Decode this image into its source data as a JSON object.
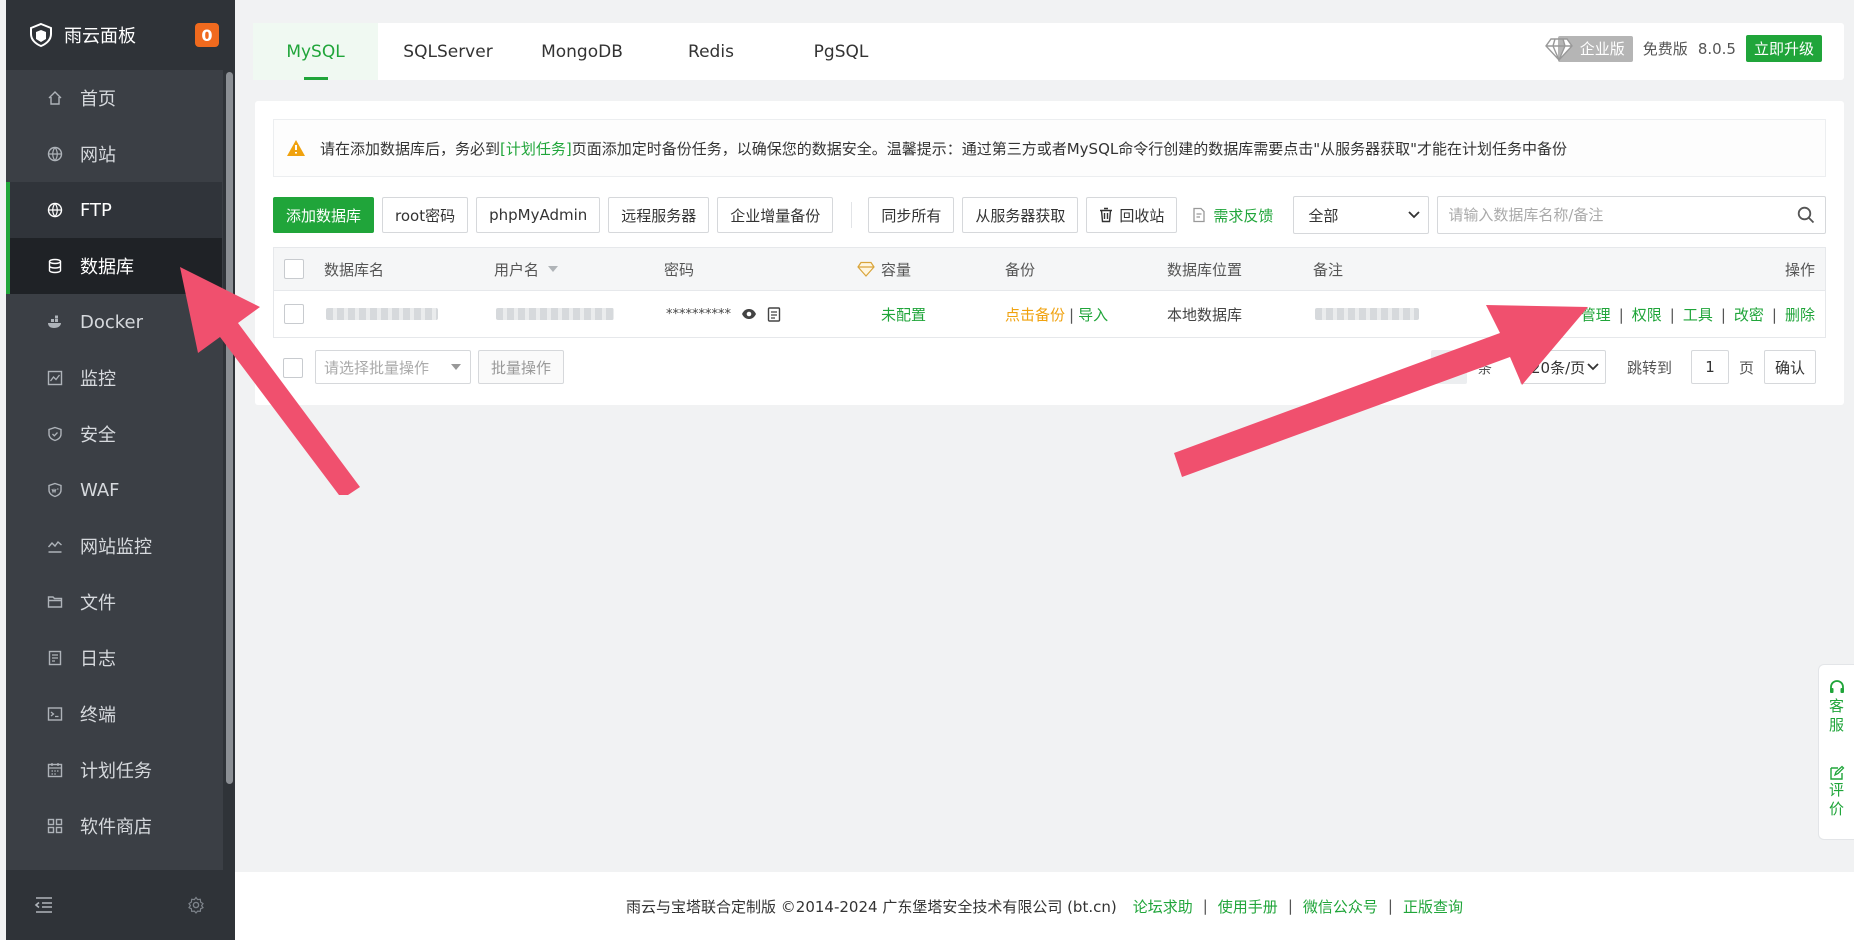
{
  "sidebar": {
    "brand": "雨云面板",
    "badge": "0",
    "items": [
      {
        "label": "首页",
        "icon": "home-icon"
      },
      {
        "label": "网站",
        "icon": "globe-icon"
      },
      {
        "label": "FTP",
        "icon": "ftp-globe-icon"
      },
      {
        "label": "数据库",
        "icon": "database-icon"
      },
      {
        "label": "Docker",
        "icon": "docker-icon"
      },
      {
        "label": "监控",
        "icon": "monitor-icon"
      },
      {
        "label": "安全",
        "icon": "shield-icon"
      },
      {
        "label": "WAF",
        "icon": "waf-shield-icon"
      },
      {
        "label": "网站监控",
        "icon": "chart-line-icon"
      },
      {
        "label": "文件",
        "icon": "folder-icon"
      },
      {
        "label": "日志",
        "icon": "log-icon"
      },
      {
        "label": "终端",
        "icon": "terminal-icon"
      },
      {
        "label": "计划任务",
        "icon": "calendar-icon"
      },
      {
        "label": "软件商店",
        "icon": "apps-icon"
      }
    ]
  },
  "topbar": {
    "tabs": [
      "MySQL",
      "SQLServer",
      "MongoDB",
      "Redis",
      "PgSQL"
    ],
    "enterprise": "企业版",
    "free": "免费版",
    "version": "8.0.5",
    "upgrade": "立即升级"
  },
  "alert": {
    "prefix": "请在添加数据库后，务必到",
    "link": "[计划任务]",
    "suffix": "页面添加定时备份任务，以确保您的数据安全。温馨提示：通过第三方或者MySQL命令行创建的数据库需要点击\"从服务器获取\"才能在计划任务中备份"
  },
  "toolbar": {
    "add_db": "添加数据库",
    "root_pwd": "root密码",
    "phpmyadmin": "phpMyAdmin",
    "remote": "远程服务器",
    "incremental": "企业增量备份",
    "sync_all": "同步所有",
    "fetch": "从服务器获取",
    "recycle": "回收站",
    "feedback": "需求反馈",
    "filter": "全部",
    "search_placeholder": "请输入数据库名称/备注"
  },
  "table": {
    "headers": {
      "name": "数据库名",
      "user": "用户名",
      "password": "密码",
      "capacity": "容量",
      "backup": "备份",
      "location": "数据库位置",
      "remark": "备注",
      "ops": "操作"
    },
    "row": {
      "password": "**********",
      "capacity": "未配置",
      "backup": "点击备份",
      "import": "导入",
      "location": "本地数据库",
      "ops": [
        "管理",
        "权限",
        "工具",
        "改密",
        "删除"
      ]
    }
  },
  "bottom": {
    "batch_placeholder": "请选择批量操作",
    "batch_btn": "批量操作",
    "total_suffix": "条",
    "per_page": "20条/页",
    "jump": "跳转到",
    "page": "1",
    "page_unit": "页",
    "confirm": "确认"
  },
  "footer": {
    "copyright": "雨云与宝塔联合定制版 ©2014-2024 广东堡塔安全技术有限公司 (bt.cn)",
    "links": [
      "论坛求助",
      "使用手册",
      "微信公众号",
      "正版查询"
    ]
  },
  "float": {
    "service": "客服",
    "rate": "评价"
  },
  "colors": {
    "accent": "#20a53a",
    "sidebar": "#3b3f45",
    "annotation": "#f0506e"
  }
}
